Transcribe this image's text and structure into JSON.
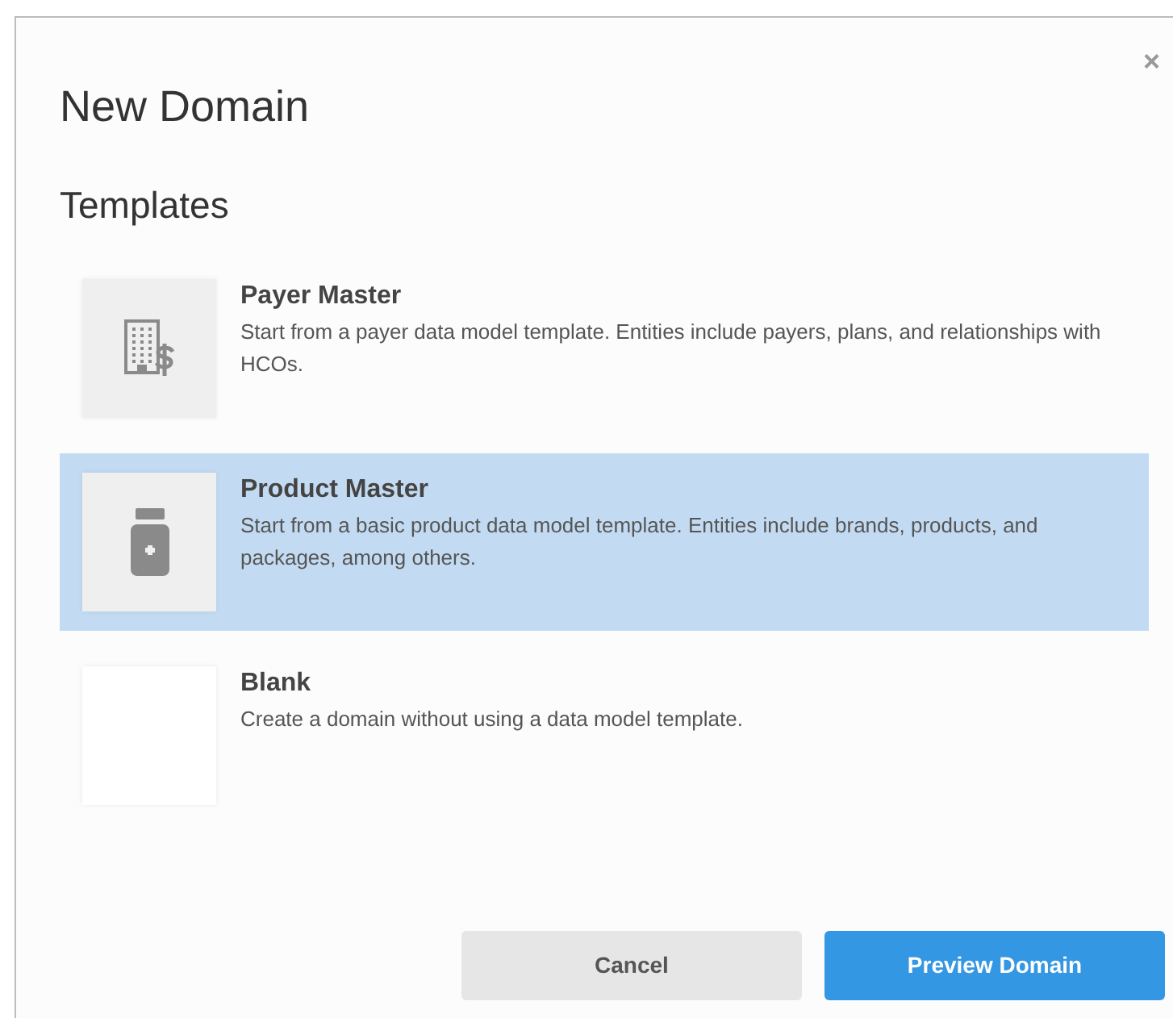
{
  "dialog": {
    "title": "New Domain",
    "close": "×",
    "section_title": "Templates",
    "templates": [
      {
        "kind": "payer",
        "name": "Payer Master",
        "description": "Start from a payer data model template. Entities include payers, plans, and relationships with HCOs.",
        "selected": false
      },
      {
        "kind": "product",
        "name": "Product Master",
        "description": "Start from a basic product data model template. Entities include brands, products, and packages, among others.",
        "selected": true
      },
      {
        "kind": "blank",
        "name": "Blank",
        "description": "Create a domain without using a data model template.",
        "selected": false
      }
    ],
    "buttons": [
      {
        "kind": "secondary",
        "label": "Cancel"
      },
      {
        "kind": "primary",
        "label": "Preview Domain"
      }
    ]
  }
}
